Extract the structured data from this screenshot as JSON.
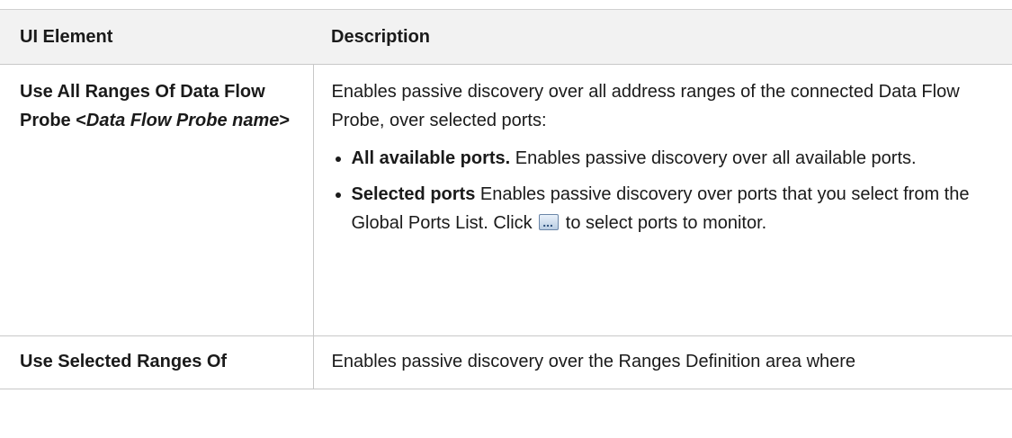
{
  "table": {
    "headers": [
      "UI Element",
      "Description"
    ],
    "row1": {
      "element_prefix": "Use All Ranges Of Data Flow Probe <",
      "element_italic": "Data Flow Probe name",
      "element_suffix": ">",
      "intro": "Enables passive discovery over all address ranges of the connected Data Flow Probe, over selected ports:",
      "bullets": [
        {
          "bold": "All available ports.",
          "text_before": " Enables passive discovery over all available ports.",
          "text_after": ""
        },
        {
          "bold": "Selected ports",
          "text_before": " Enables passive discovery over ports that you select from the Global Ports List. Click ",
          "icon": "browse-ellipsis-icon",
          "text_after": " to select ports to monitor."
        }
      ]
    },
    "row2": {
      "element": "Use Selected Ranges Of",
      "description": "Enables passive discovery over the Ranges Definition area where"
    }
  }
}
